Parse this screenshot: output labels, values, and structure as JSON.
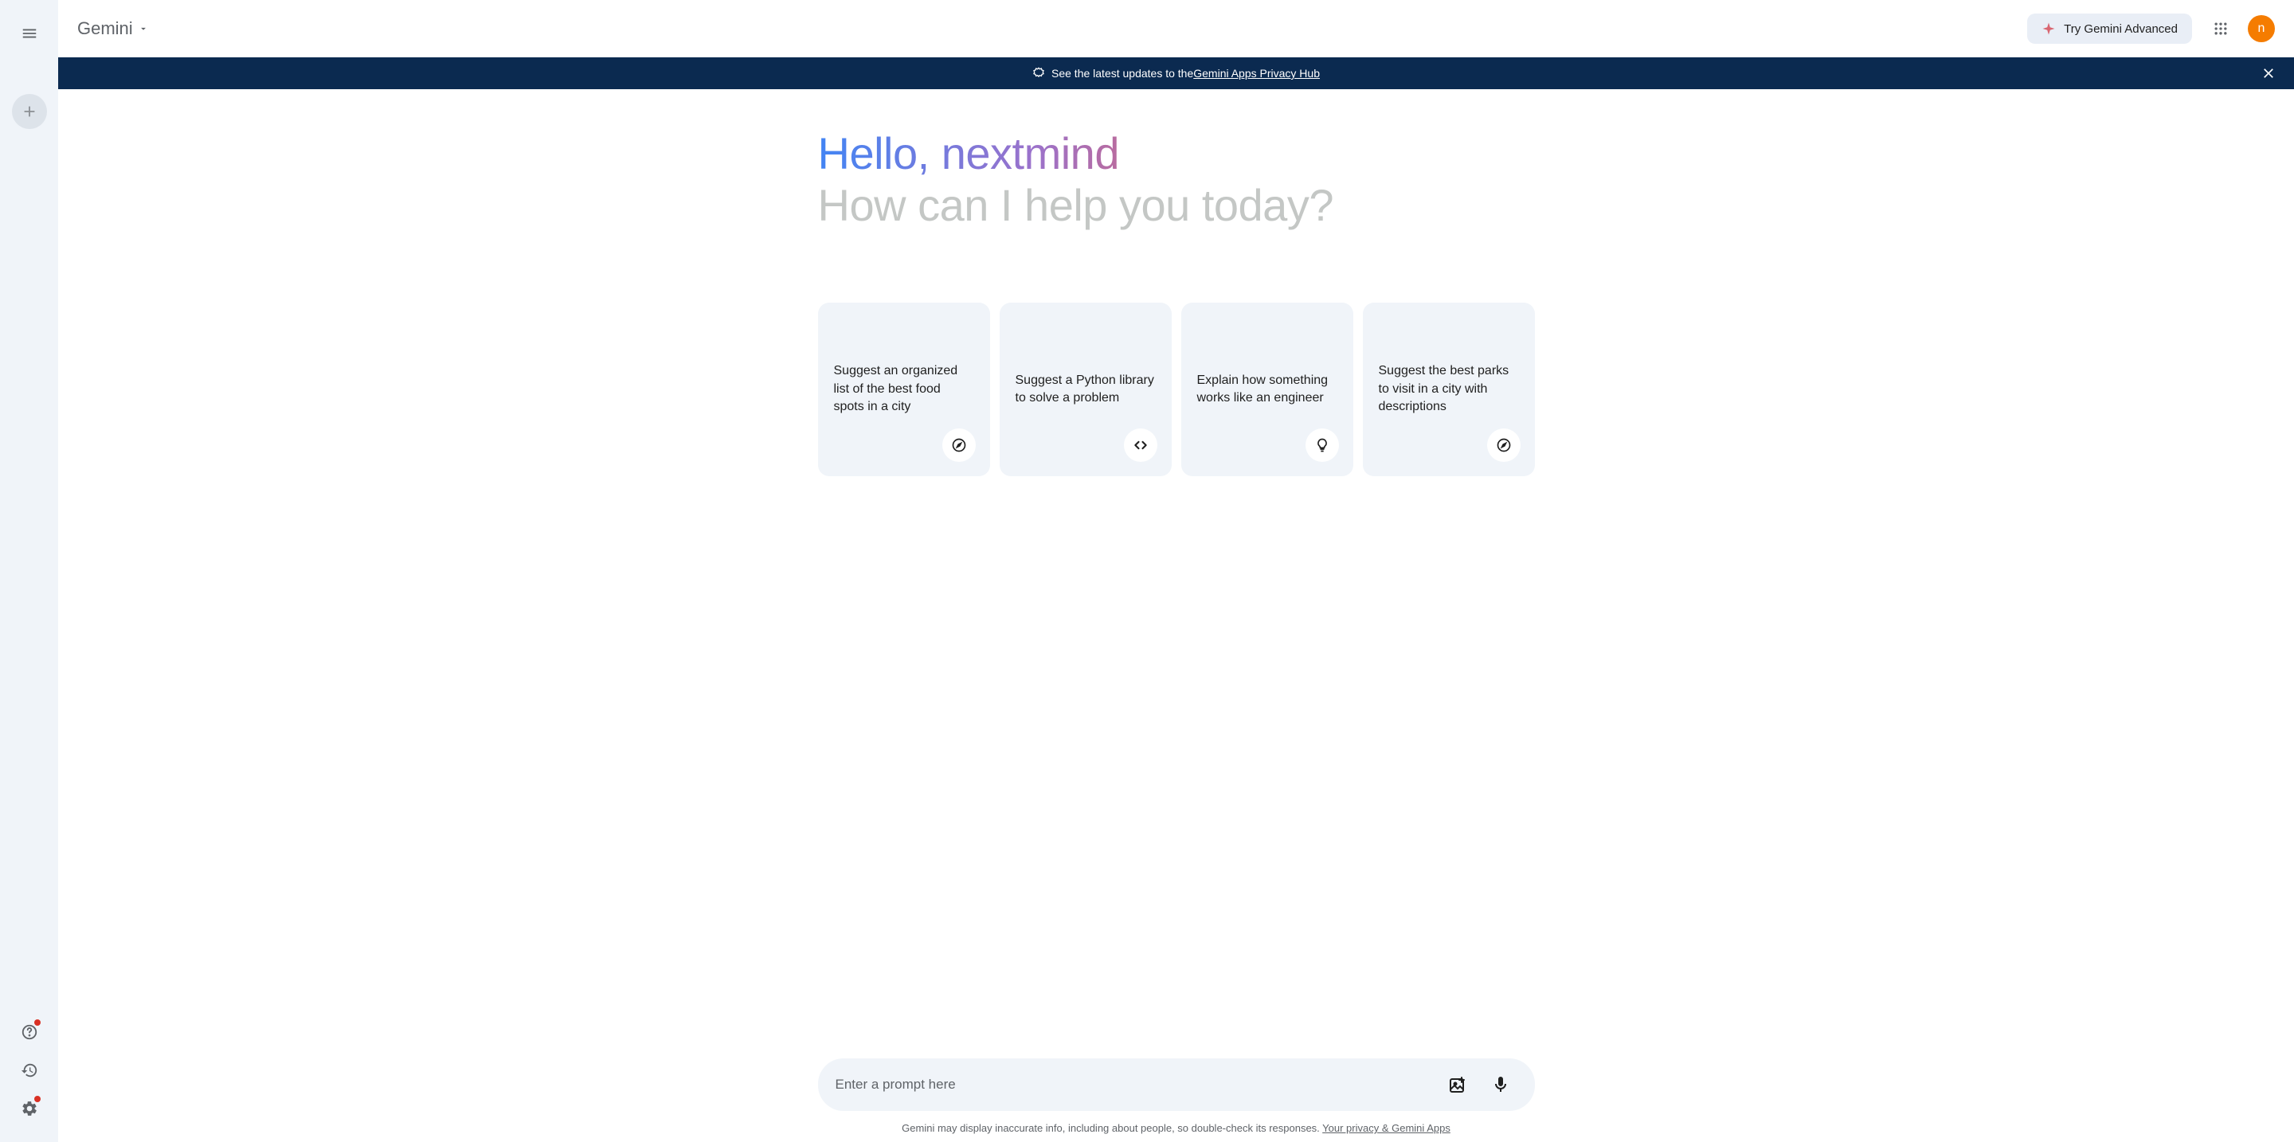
{
  "header": {
    "app_title": "Gemini",
    "try_advanced_label": "Try Gemini Advanced",
    "avatar_initial": "n"
  },
  "banner": {
    "text_prefix": "See the latest updates to the ",
    "link_text": "Gemini Apps Privacy Hub"
  },
  "main": {
    "greeting": "Hello, nextmind",
    "subgreeting": "How can I help you today?"
  },
  "cards": [
    {
      "text": "Suggest an organized list of the best food spots in a city",
      "icon": "compass"
    },
    {
      "text": "Suggest a Python library to solve a problem",
      "icon": "code"
    },
    {
      "text": "Explain how something works like an engineer",
      "icon": "lightbulb"
    },
    {
      "text": "Suggest the best parks to visit in a city with descriptions",
      "icon": "compass"
    }
  ],
  "input": {
    "placeholder": "Enter a prompt here"
  },
  "footer": {
    "disclaimer_text": "Gemini may display inaccurate info, including about people, so double-check its responses. ",
    "disclaimer_link": "Your privacy & Gemini Apps"
  }
}
